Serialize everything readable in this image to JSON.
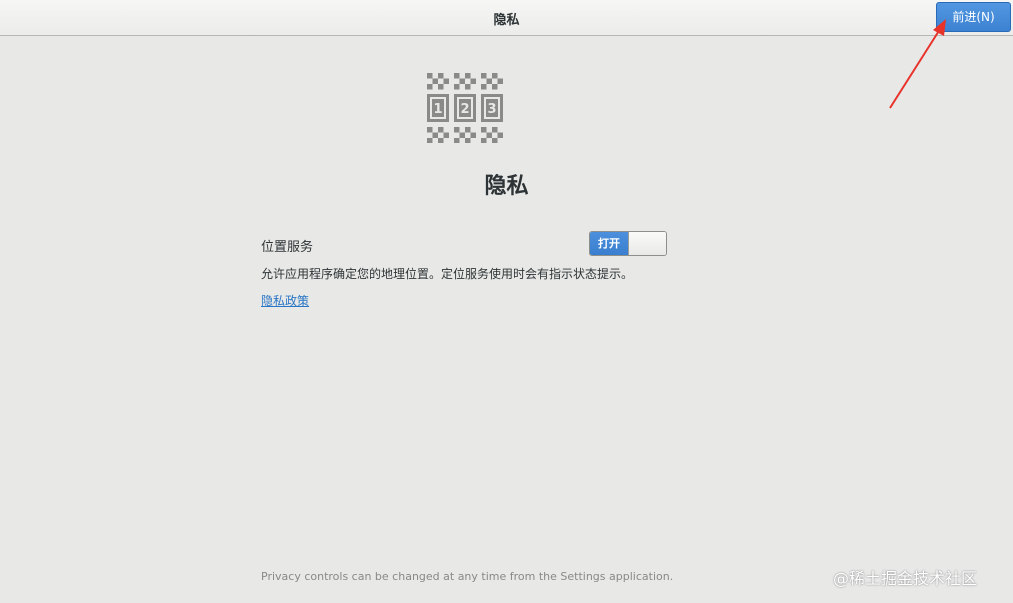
{
  "header": {
    "title": "隐私",
    "next_button_label": "前进(N)"
  },
  "logo": {
    "icon": "privacy-123-icon",
    "digits": [
      "1",
      "2",
      "3"
    ]
  },
  "page": {
    "title": "隐私"
  },
  "location_service": {
    "label": "位置服务",
    "toggle_label": "打开",
    "toggle_state": "on",
    "description": "允许应用程序确定您的地理位置。定位服务使用时会有指示状态提示。"
  },
  "policy_link": "隐私政策",
  "footer": {
    "text": "Privacy controls can be changed at any time from the Settings application."
  },
  "watermark": "@稀土掘金技术社区",
  "colors": {
    "accent": "#3c82d2",
    "link": "#2a76c6",
    "background": "#e8e8e7",
    "annotation_arrow": "#e8332b"
  }
}
